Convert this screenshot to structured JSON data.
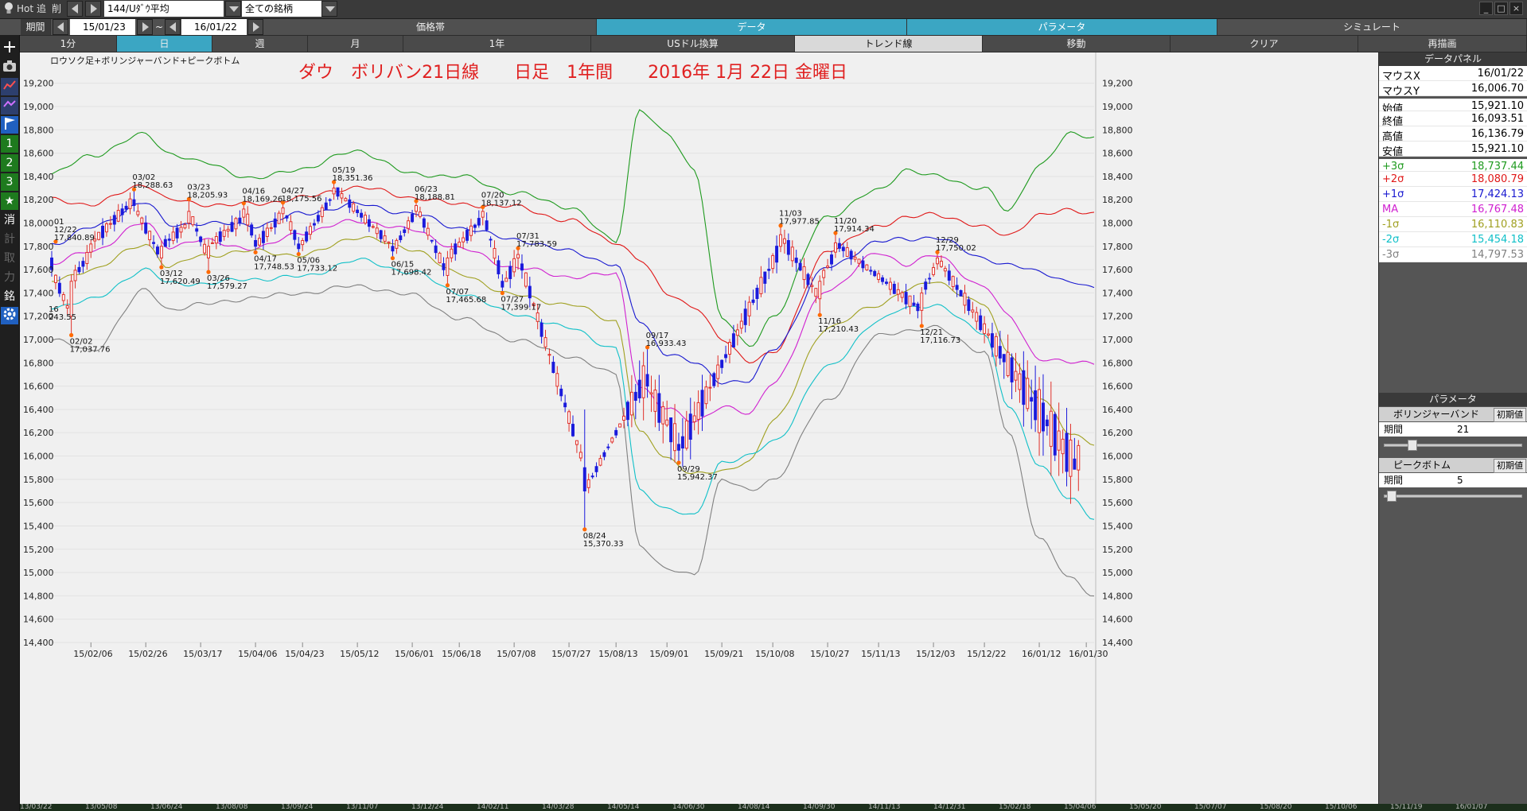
{
  "toolbar": {
    "hot_label": "Hot",
    "add_label": "追",
    "del_label": "削",
    "symbol_value": "144/Uﾀﾞｳ平均",
    "filter_value": "全ての銘柄"
  },
  "period_bar": {
    "label": "期間",
    "start": "15/01/23",
    "tilde": "~",
    "end": "16/01/22"
  },
  "header_tabs": [
    {
      "label": "価格帯"
    },
    {
      "label": "データ"
    },
    {
      "label": "パラメータ"
    },
    {
      "label": "シミュレート"
    }
  ],
  "sub_tabs": [
    {
      "label": "1分"
    },
    {
      "label": "日"
    },
    {
      "label": "週"
    },
    {
      "label": "月"
    },
    {
      "label": "1年"
    },
    {
      "label": "USドル換算"
    },
    {
      "label": "トレンド線"
    },
    {
      "label": "移動"
    },
    {
      "label": "クリア"
    },
    {
      "label": "再描画"
    }
  ],
  "sidebar_icons": [
    "search-icon",
    "plus-icon",
    "camera-icon",
    "line-chart-icon",
    "indicator-chart-icon",
    "flag-icon",
    "preset-1",
    "preset-2",
    "preset-3",
    "star-icon",
    "erase-icon",
    "sign-icon",
    "trade-icon",
    "force-icon",
    "stock-icon",
    "gear-icon"
  ],
  "sidebar_texts": {
    "n1": "1",
    "n2": "2",
    "n3": "3",
    "erase": "消",
    "sign": "計",
    "trade": "取",
    "force": "力",
    "stock": "銘"
  },
  "colors": {
    "up": "#e0302a",
    "down": "#1a1adc",
    "plus3": "#1e9a1e",
    "plus2": "#e01818",
    "plus1": "#1818d0",
    "ma": "#d020d0",
    "minus1": "#a0a020",
    "minus2": "#10c0c8",
    "minus3": "#808080",
    "title_red": "#e02020",
    "accent": "#3ba6c3"
  },
  "chart_data": {
    "type": "candlestick",
    "legend_text": "ロウソク足+ボリンジャーバンド+ピークボトム",
    "title": "ダウ　ボリバン21日線　　日足　1年間　　2016年 1月 22日 金曜日",
    "ylim": [
      14400,
      19300
    ],
    "y_ticks": [
      19200,
      19000,
      18800,
      18600,
      18400,
      18200,
      18000,
      17800,
      17600,
      17400,
      17200,
      17000,
      16800,
      16600,
      16400,
      16200,
      16000,
      15800,
      15600,
      15400,
      15200,
      15000,
      14800,
      14600,
      14400
    ],
    "y_tick_labels": [
      "19,200",
      "19,000",
      "18,800",
      "18,600",
      "18,400",
      "18,200",
      "18,000",
      "17,800",
      "17,600",
      "17,400",
      "17,200",
      "17,000",
      "16,800",
      "16,600",
      "16,400",
      "16,200",
      "16,000",
      "15,800",
      "15,600",
      "15,400",
      "15,200",
      "15,000",
      "14,800",
      "14,600",
      "14,400"
    ],
    "x_tick_labels": [
      "15/02/06",
      "15/02/26",
      "15/03/17",
      "15/04/06",
      "15/04/23",
      "15/05/12",
      "15/06/01",
      "15/06/18",
      "15/07/08",
      "15/07/27",
      "15/08/13",
      "15/09/01",
      "15/09/21",
      "15/10/08",
      "15/10/27",
      "15/11/13",
      "15/12/03",
      "15/12/22",
      "16/01/12",
      "16/01/30"
    ],
    "x_tick_index": [
      10,
      24,
      38,
      52,
      64,
      78,
      92,
      104,
      118,
      132,
      144,
      157,
      171,
      184,
      198,
      211,
      225,
      238,
      252,
      264
    ],
    "n_days": 266,
    "bands_x": [
      0,
      10,
      24,
      30,
      38,
      52,
      64,
      78,
      92,
      104,
      118,
      132,
      144,
      150,
      157,
      164,
      171,
      178,
      184,
      198,
      211,
      218,
      225,
      238,
      244,
      252,
      260,
      266
    ],
    "ma": [
      17650,
      17760,
      18000,
      17800,
      17850,
      17780,
      17920,
      18020,
      17940,
      17780,
      17620,
      17540,
      17560,
      16600,
      16400,
      16300,
      16420,
      16360,
      16640,
      17430,
      17740,
      17650,
      17720,
      17460,
      17200,
      16840,
      16800,
      16800
    ],
    "plus1": [
      17820,
      17960,
      18180,
      17980,
      18000,
      17980,
      18080,
      18160,
      18080,
      17960,
      17860,
      17760,
      17640,
      17160,
      16880,
      16800,
      16640,
      16640,
      16920,
      17620,
      17840,
      17860,
      17880,
      17700,
      17640,
      17580,
      17500,
      17430
    ],
    "plus2": [
      18200,
      18160,
      18330,
      18200,
      18160,
      18160,
      18220,
      18310,
      18220,
      18160,
      18140,
      18020,
      17840,
      17680,
      17400,
      17280,
      17000,
      16820,
      16880,
      17760,
      17980,
      18040,
      18080,
      17960,
      17900,
      18060,
      18120,
      18080
    ],
    "plus3": [
      18420,
      18580,
      18760,
      18600,
      18520,
      18380,
      18470,
      18620,
      18420,
      18400,
      18260,
      18140,
      17840,
      18980,
      18760,
      18460,
      17180,
      16940,
      17200,
      18060,
      18280,
      18460,
      18400,
      18300,
      18100,
      18500,
      18760,
      18740
    ],
    "minus1": [
      17500,
      17600,
      17820,
      17620,
      17720,
      17760,
      17720,
      17880,
      17780,
      17560,
      17380,
      17300,
      17160,
      16200,
      15980,
      15850,
      15860,
      15960,
      16300,
      17100,
      17300,
      17420,
      17500,
      17300,
      16900,
      16500,
      16200,
      16110
    ],
    "minus2": [
      17280,
      17340,
      17600,
      17480,
      17480,
      17520,
      17540,
      17680,
      17580,
      17400,
      17220,
      17100,
      16920,
      15700,
      15550,
      15480,
      15950,
      16000,
      16120,
      16760,
      17160,
      17270,
      17300,
      17060,
      16440,
      15920,
      15640,
      15454
    ],
    "minus3": [
      17000,
      16900,
      17420,
      17260,
      17300,
      17360,
      17400,
      17460,
      17380,
      17180,
      17000,
      16860,
      16700,
      15240,
      15020,
      14980,
      15800,
      15700,
      15800,
      16480,
      17030,
      17080,
      17100,
      16900,
      16200,
      15300,
      14940,
      14798
    ],
    "peaks": [
      {
        "i": 1,
        "v": 17840.89,
        "label": "01\n12/22\n17,840.89",
        "pos": "above"
      },
      {
        "i": 5,
        "v": 17037.76,
        "label": "02/02\n17,037.76",
        "pos": "below"
      },
      {
        "i": 21,
        "v": 18288.63,
        "label": "03/02\n18,288.63",
        "pos": "above"
      },
      {
        "i": 28,
        "v": 17620.49,
        "label": "03/12\n17,620.49",
        "pos": "below"
      },
      {
        "i": 35,
        "v": 18205.93,
        "label": "03/23\n18,205.93",
        "pos": "above"
      },
      {
        "i": 40,
        "v": 17579.27,
        "label": "03/26\n17,579.27",
        "pos": "below"
      },
      {
        "i": 49,
        "v": 18169.26,
        "label": "04/16\n18,169.26",
        "pos": "above"
      },
      {
        "i": 52,
        "v": 17748.53,
        "label": "04/17\n17,748.53",
        "pos": "below"
      },
      {
        "i": 59,
        "v": 18175.56,
        "label": "04/27\n18,175.56",
        "pos": "above"
      },
      {
        "i": 63,
        "v": 17733.12,
        "label": "05/06\n17,733.12",
        "pos": "below"
      },
      {
        "i": 72,
        "v": 18351.36,
        "label": "05/19\n18,351.36",
        "pos": "above"
      },
      {
        "i": 87,
        "v": 17698.42,
        "label": "06/15\n17,698.42",
        "pos": "below"
      },
      {
        "i": 93,
        "v": 18188.81,
        "label": "06/23\n18,188.81",
        "pos": "above"
      },
      {
        "i": 101,
        "v": 17465.68,
        "label": "07/07\n17,465.68",
        "pos": "below"
      },
      {
        "i": 110,
        "v": 18137.12,
        "label": "07/20\n18,137.12",
        "pos": "above"
      },
      {
        "i": 115,
        "v": 17399.17,
        "label": "07/27\n17,399.17",
        "pos": "below"
      },
      {
        "i": 119,
        "v": 17783.59,
        "label": "07/31\n17,783.59",
        "pos": "above"
      },
      {
        "i": 136,
        "v": 15370.33,
        "label": "08/24\n15,370.33",
        "pos": "below"
      },
      {
        "i": 152,
        "v": 16933.43,
        "label": "09/17\n16,933.43",
        "pos": "above"
      },
      {
        "i": 160,
        "v": 15942.37,
        "label": "09/29\n15,942.37",
        "pos": "below"
      },
      {
        "i": 186,
        "v": 17977.85,
        "label": "11/03\n17,977.85",
        "pos": "above"
      },
      {
        "i": 196,
        "v": 17210.43,
        "label": "11/16\n17,210.43",
        "pos": "below"
      },
      {
        "i": 200,
        "v": 17914.34,
        "label": "11/20\n17,914.34",
        "pos": "above"
      },
      {
        "i": 222,
        "v": 17116.73,
        "label": "12/21\n17,116.73",
        "pos": "below"
      },
      {
        "i": 226,
        "v": 17750.02,
        "label": "12/29\n17,750.02",
        "pos": "above"
      }
    ],
    "left_cut_labels": [
      {
        "v": 17240,
        "label": "16\n243.55"
      }
    ],
    "candles": [
      {
        "x": 0,
        "o": 17700,
        "c": 17600,
        "h": 17760,
        "l": 17540
      },
      {
        "x": 5,
        "o": 17200,
        "c": 17500,
        "h": 17560,
        "l": 17040
      },
      {
        "x": 10,
        "o": 17750,
        "c": 17820,
        "h": 17860,
        "l": 17700
      },
      {
        "x": 21,
        "o": 18200,
        "c": 18150,
        "h": 18290,
        "l": 18100
      },
      {
        "x": 28,
        "o": 17700,
        "c": 17800,
        "h": 17850,
        "l": 17620
      },
      {
        "x": 35,
        "o": 18000,
        "c": 18100,
        "h": 18206,
        "l": 17950
      },
      {
        "x": 40,
        "o": 17700,
        "c": 17800,
        "h": 17860,
        "l": 17580
      },
      {
        "x": 49,
        "o": 18050,
        "c": 18120,
        "h": 18170,
        "l": 18000
      },
      {
        "x": 52,
        "o": 17850,
        "c": 17800,
        "h": 17900,
        "l": 17750
      },
      {
        "x": 59,
        "o": 18080,
        "c": 18130,
        "h": 18176,
        "l": 18000
      },
      {
        "x": 63,
        "o": 17820,
        "c": 17780,
        "h": 17880,
        "l": 17733
      },
      {
        "x": 72,
        "o": 18250,
        "c": 18300,
        "h": 18351,
        "l": 18200
      },
      {
        "x": 87,
        "o": 17800,
        "c": 17760,
        "h": 17860,
        "l": 17698
      },
      {
        "x": 93,
        "o": 18100,
        "c": 18150,
        "h": 18189,
        "l": 18050
      },
      {
        "x": 101,
        "o": 17550,
        "c": 17700,
        "h": 17760,
        "l": 17466
      },
      {
        "x": 110,
        "o": 18050,
        "c": 18100,
        "h": 18137,
        "l": 17980
      },
      {
        "x": 115,
        "o": 17500,
        "c": 17450,
        "h": 17560,
        "l": 17399
      },
      {
        "x": 119,
        "o": 17700,
        "c": 17730,
        "h": 17784,
        "l": 17600
      },
      {
        "x": 136,
        "o": 15900,
        "c": 15700,
        "h": 16400,
        "l": 15370
      },
      {
        "x": 152,
        "o": 16700,
        "c": 16600,
        "h": 16933,
        "l": 16500
      },
      {
        "x": 160,
        "o": 16100,
        "c": 16050,
        "h": 16200,
        "l": 15942
      },
      {
        "x": 186,
        "o": 17800,
        "c": 17900,
        "h": 17978,
        "l": 17750
      },
      {
        "x": 196,
        "o": 17350,
        "c": 17500,
        "h": 17550,
        "l": 17210
      },
      {
        "x": 200,
        "o": 17750,
        "c": 17830,
        "h": 17914,
        "l": 17700
      },
      {
        "x": 222,
        "o": 17250,
        "c": 17400,
        "h": 17450,
        "l": 17117
      },
      {
        "x": 226,
        "o": 17650,
        "c": 17700,
        "h": 17750,
        "l": 17600
      },
      {
        "x": 262,
        "o": 15880,
        "c": 16090,
        "h": 16137,
        "l": 15700
      }
    ]
  },
  "data_panel": {
    "title": "データパネル",
    "rows": [
      {
        "k": "マウスX",
        "v": "16/01/22",
        "color": "#000"
      },
      {
        "k": "マウスY",
        "v": "16,006.70",
        "color": "#000"
      },
      {
        "k": "始値",
        "v": "15,921.10",
        "color": "#000"
      },
      {
        "k": "終値",
        "v": "16,093.51",
        "color": "#000"
      },
      {
        "k": "高値",
        "v": "16,136.79",
        "color": "#000"
      },
      {
        "k": "安値",
        "v": "15,921.10",
        "color": "#000"
      },
      {
        "k": "+3σ",
        "v": "18,737.44",
        "color": "#1e9a1e"
      },
      {
        "k": "+2σ",
        "v": "18,080.79",
        "color": "#e01818"
      },
      {
        "k": "+1σ",
        "v": "17,424.13",
        "color": "#1818d0"
      },
      {
        "k": "MA",
        "v": "16,767.48",
        "color": "#d020d0"
      },
      {
        "k": "-1σ",
        "v": "16,110.83",
        "color": "#a0a020"
      },
      {
        "k": "-2σ",
        "v": "15,454.18",
        "color": "#10c0c8"
      },
      {
        "k": "-3σ",
        "v": "14,797.53",
        "color": "#808080"
      }
    ]
  },
  "param_panel": {
    "title": "パラメータ",
    "bb_label": "ボリンジャーバンド",
    "bb_init": "初期値",
    "bb_period_label": "期間",
    "bb_period_value": "21",
    "bb_fraction": 0.18,
    "pb_label": "ピークボトム",
    "pb_init": "初期値",
    "pb_period_label": "期間",
    "pb_period_value": "5",
    "pb_fraction": 0.02
  },
  "bottom_strip": [
    "13/03/22",
    "13/05/08",
    "13/06/24",
    "13/08/08",
    "13/09/24",
    "13/11/07",
    "13/12/24",
    "14/02/11",
    "14/03/28",
    "14/05/14",
    "14/06/30",
    "14/08/14",
    "14/09/30",
    "14/11/13",
    "14/12/31",
    "15/02/18",
    "15/04/06",
    "15/05/20",
    "15/07/07",
    "15/08/20",
    "15/10/06",
    "15/11/19",
    "16/01/07"
  ]
}
